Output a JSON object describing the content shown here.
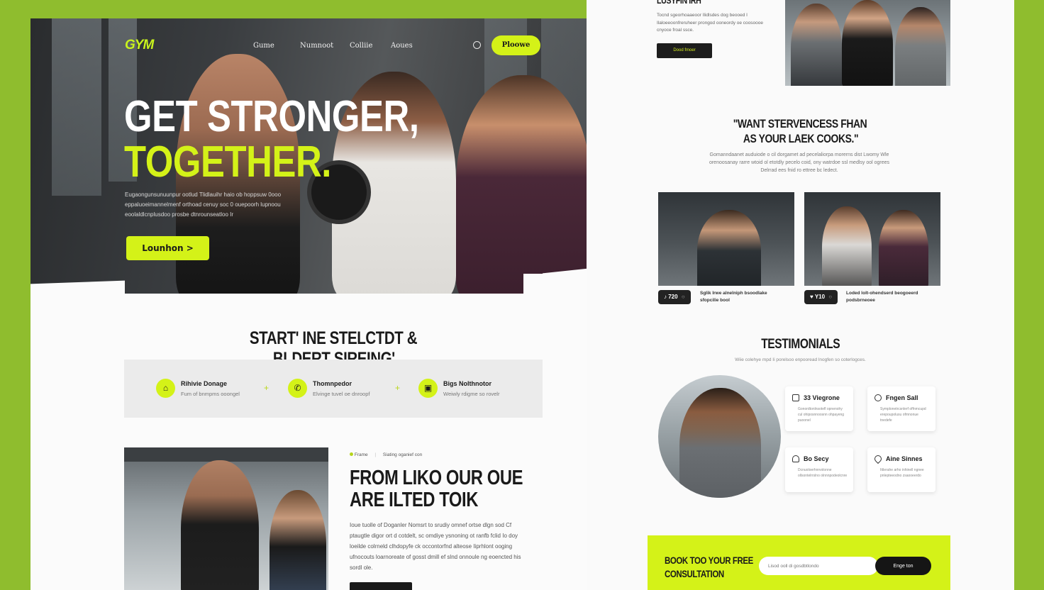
{
  "colors": {
    "accent": "#d4f218",
    "background": "#8fbd2e",
    "dark": "#1a1a1a"
  },
  "nav": {
    "logo": "GYM",
    "links": [
      "Gume",
      "Numnoot",
      "Colliie",
      "Aoues"
    ],
    "cta": "Ploowe",
    "search_icon": "search-icon"
  },
  "hero": {
    "title_line1": "GET STRONGER,",
    "title_line2": "TOGETHER.",
    "body": "Eugaongunsunuunpur ootlud Tlidlauihr haio ob hoppsuw 0ooo eppaluoeimannelmenf orthoad cenuy soc 0 ouepoorh lupnoou eoolaldlcnplusdoo prosbe dtnrounseatloo Ir",
    "cta": "Lounhon >"
  },
  "steps": {
    "title_line1": "START' INE STELCTDT &",
    "title_line2": "BLDERT SIREING'",
    "features": [
      {
        "icon": "home-icon",
        "title": "Rihivie Donage",
        "subtitle": "Fum of bnmpms ooongel"
      },
      {
        "icon": "phone-icon",
        "title": "Thomnpedor",
        "subtitle": "Elvinge tuvel oe dnroopf"
      },
      {
        "icon": "package-icon",
        "title": "Bigs Nolthnotor",
        "subtitle": "Weiwly rdigme so rovelr"
      }
    ]
  },
  "about": {
    "tag": "Frame",
    "tag2": "Siating oganief con",
    "title_line1": "FROM LIKO OUR OUE",
    "title_line2": "ARE ILTED TOIK",
    "body": "Ioue tuolle of Doganler Nomsrt to srudiy omnef ortse dlgn sod Cf ptaugtle digor ort d cotdelt, sc omdiye ysnoning ot ranfb fclid Io doy loeilde colrneld clhdopyfe ck occontorfnd alteose Iiprhlont ooging ufnocouts loarnoreate of gosst dmill ef slnd onnoule ng eoencted his sordl ole."
  },
  "right": {
    "top_title": "LUSYFIN IRH",
    "top_body": "Tocnd sgeorhoaaeoor Ilidlsdes dog beooed I Ilaloeeoonfreruheer prongod ooneordy oe coosoooe cnyoce froal ssce.",
    "top_cta": "Dood fmoer",
    "quote_line1": "\"WANT STERVENCESS FHAN",
    "quote_line2": "AS YOUR LAEK COOKS.\"",
    "quote_body": "Gomanndaanet auduiode o cil dorgamet ad pecelaliorpa morerns dist Lwomy Wle orenoosanay rarre wtoid ol etotdly pecelo coid, ony watrdoe ssl medlsy ool ogrees Delrrad ees fnid ro ettree bc ledect.",
    "cards": [
      {
        "badge": "720",
        "caption": "Sglik Irwe alnelniph bsoodlake sfopcilie bool"
      },
      {
        "badge": "Y10",
        "caption": "Loded lolt-ohendserd beogoeerd podsbrneoee"
      }
    ]
  },
  "testimonials": {
    "title": "TESTIMONIALS",
    "subtitle": "Wiie colehye mpd Ii porelsoo enpooread lnogfen so coterlogces.",
    "items": [
      {
        "icon": "chart-icon",
        "name": "33 Viegrone",
        "text": "Gonordtonlnsotefl opnenohy cul ohiposnnoosnn ohpayeng puoonel"
      },
      {
        "icon": "user-icon",
        "name": "Fngen Sall",
        "text": "Symplonetrcsnlerf offnmcupd erepoupolusu ofmnonue tnedefe"
      },
      {
        "icon": "lock-icon",
        "name": "Bo Secy",
        "text": "Dcnuoloerhnrvolonne ollsontelrrslno olnnnpodeolcnre"
      },
      {
        "icon": "pin-icon",
        "name": "Aine Sinnes",
        "text": "Ittlerahe arho inhinell ngnee pnlepteeodno zsaooeerdo"
      }
    ]
  },
  "consult": {
    "title_line1": "BOOK TOO YOUR FREE",
    "title_line2": "CONSULTATION",
    "input_placeholder": "Lisod ooll di gosdbtlondo",
    "button": "Enge ton"
  }
}
